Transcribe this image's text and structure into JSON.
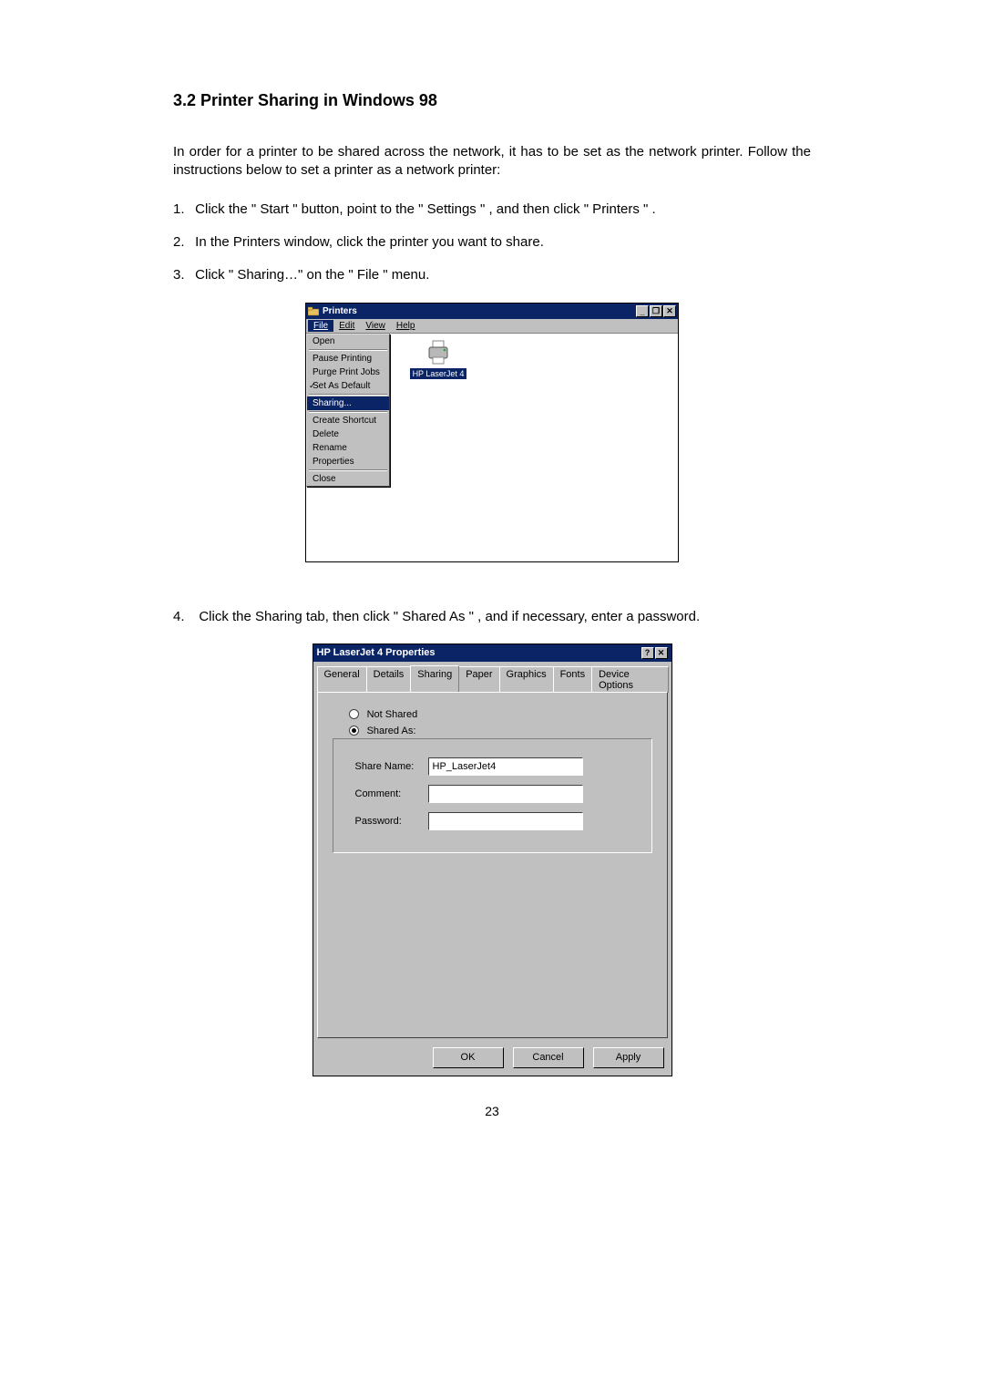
{
  "heading": "3.2 Printer Sharing in Windows 98",
  "intro": "In order for a printer to be shared across the network, it has to be set as the network printer.  Follow the instructions below to set a printer as a network printer:",
  "steps": [
    "Click the  \" Start \"  button, point to the  \" Settings \" , and then click  \" Printers \" .",
    "In the Printers window, click the printer you want to share.",
    "Click  \" Sharing…\"  on the  \" File \"   menu.",
    "Click the Sharing tab, then click  \" Shared As \" , and if necessary, enter a password."
  ],
  "page_number": "23",
  "printers_window": {
    "title": "Printers",
    "menus": {
      "file": "File",
      "edit": "Edit",
      "view": "View",
      "help": "Help"
    },
    "win_controls": {
      "min": "_",
      "max": "❐",
      "close": "✕"
    },
    "file_menu": {
      "open": "Open",
      "pause": "Pause Printing",
      "purge": "Purge Print Jobs",
      "setdefault": "Set As Default",
      "sharing": "Sharing...",
      "shortcut": "Create Shortcut",
      "del": "Delete",
      "rename": "Rename",
      "props": "Properties",
      "close": "Close"
    },
    "printer_label": "HP LaserJet 4"
  },
  "properties_dialog": {
    "title": "HP LaserJet 4 Properties",
    "title_controls": {
      "help": "?",
      "close": "✕"
    },
    "tabs": [
      "General",
      "Details",
      "Sharing",
      "Paper",
      "Graphics",
      "Fonts",
      "Device Options"
    ],
    "active_tab": "Sharing",
    "radios": {
      "not_shared": "Not Shared",
      "shared_as": "Shared As:"
    },
    "fields": {
      "share_name_label": "Share Name:",
      "share_name_value": "HP_LaserJet4",
      "comment_label": "Comment:",
      "comment_value": "",
      "password_label": "Password:",
      "password_value": ""
    },
    "buttons": {
      "ok": "OK",
      "cancel": "Cancel",
      "apply": "Apply"
    }
  }
}
